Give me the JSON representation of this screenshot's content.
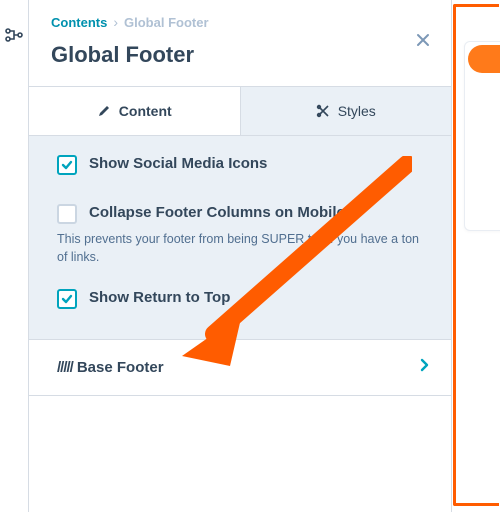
{
  "breadcrumb": {
    "root": "Contents",
    "current": "Global Footer"
  },
  "title": "Global Footer",
  "tabs": {
    "content": "Content",
    "styles": "Styles"
  },
  "fields": {
    "social": {
      "label": "Show Social Media Icons",
      "checked": true
    },
    "collapse": {
      "label": "Collapse Footer Columns on Mobile",
      "checked": false,
      "help": "This prevents your footer from being SUPER tall if you have a ton of links."
    },
    "return_top": {
      "label": "Show Return to Top",
      "checked": true
    }
  },
  "accordion": {
    "prefix": "/////",
    "label": "Base Footer"
  },
  "colors": {
    "accent": "#00a4bd",
    "highlight": "#ff5c00"
  }
}
